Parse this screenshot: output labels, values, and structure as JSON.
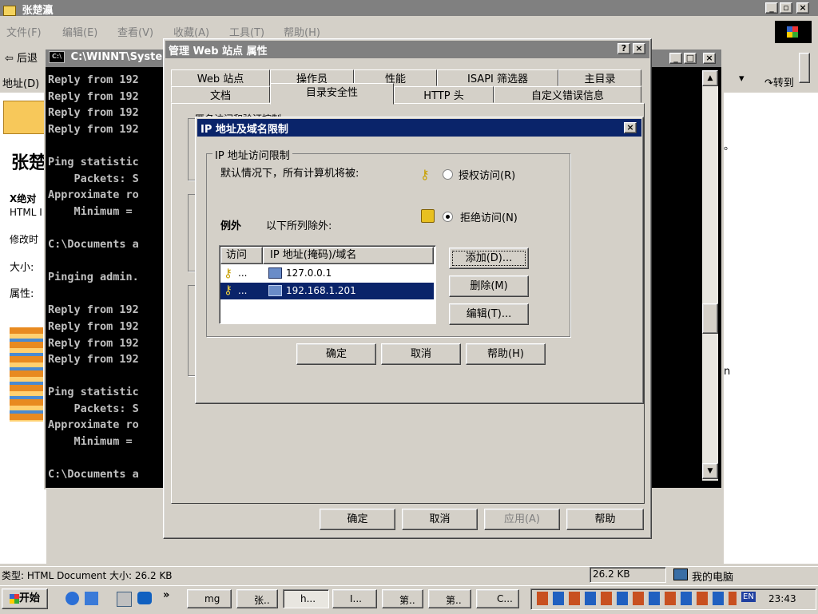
{
  "explorer": {
    "title": "张楚瀛",
    "menu": [
      "文件(F)",
      "编辑(E)",
      "查看(V)",
      "收藏(A)",
      "工具(T)",
      "帮助(H)"
    ],
    "back_label": "后退",
    "address_label": "地址(D)",
    "go_label": "转到",
    "page_title": "张楚",
    "side_items": [
      "X绝对",
      "HTML I",
      "修改时",
      "大小:",
      "属性:"
    ],
    "right_text_1": "。",
    "right_text_2": "n",
    "status_type": "类型: HTML Document 大小: 26.2 KB",
    "status_size": "26.2 KB",
    "status_zone": "我的电脑"
  },
  "console": {
    "title": "C:\\WINNT\\System",
    "lines": [
      "Reply from 192",
      "Reply from 192",
      "Reply from 192",
      "Reply from 192",
      "",
      "Ping statistic",
      "    Packets: S",
      "Approximate ro",
      "    Minimum = ",
      "",
      "C:\\Documents a",
      "",
      "Pinging admin.",
      "",
      "Reply from 192",
      "Reply from 192",
      "Reply from 192",
      "Reply from 192",
      "",
      "Ping statistic",
      "    Packets: S",
      "Approximate ro",
      "    Minimum = ",
      "",
      "C:\\Documents a"
    ]
  },
  "props": {
    "title": "管理 Web 站点 属性",
    "help_btn": "?",
    "close_btn": "×",
    "tabs_row1": [
      "Web 站点",
      "操作员",
      "性能",
      "ISAPI 筛选器",
      "主目录"
    ],
    "tabs_row2": [
      "文档",
      "目录安全性",
      "HTTP 头",
      "自定义错误信息"
    ],
    "partial_label": "匿名访问和验证控制",
    "ok": "确定",
    "cancel": "取消",
    "apply": "应用(A)",
    "help": "帮助"
  },
  "ipdlg": {
    "title": "IP 地址及域名限制",
    "close_btn": "×",
    "group_label": "IP 地址访问限制",
    "default_text": "默认情况下，所有计算机将被:",
    "grant_label": "授权访问(R)",
    "deny_label": "拒绝访问(N)",
    "except_label": "例外",
    "except_text": "以下所列除外:",
    "col_access": "访问",
    "col_ip": "IP 地址(掩码)/域名",
    "rows": [
      {
        "access": "...",
        "ip": "127.0.0.1",
        "selected": false
      },
      {
        "access": "...",
        "ip": "192.168.1.201",
        "selected": true
      }
    ],
    "add": "添加(D)...",
    "remove": "删除(M)",
    "edit": "编辑(T)...",
    "ok": "确定",
    "cancel": "取消",
    "help": "帮助(H)"
  },
  "taskbar": {
    "start": "开始",
    "buttons": [
      "mg",
      "张..",
      "h...",
      "I...",
      "第..",
      "第..",
      "C..."
    ],
    "clock": "23:43",
    "lang": "EN"
  },
  "colors": {
    "desktop": "#d4d0c8",
    "title_active": "#0a246a",
    "title_inactive": "#808080",
    "console_bg": "#000000",
    "console_fg": "#c0c0c0",
    "selection": "#0a246a"
  }
}
